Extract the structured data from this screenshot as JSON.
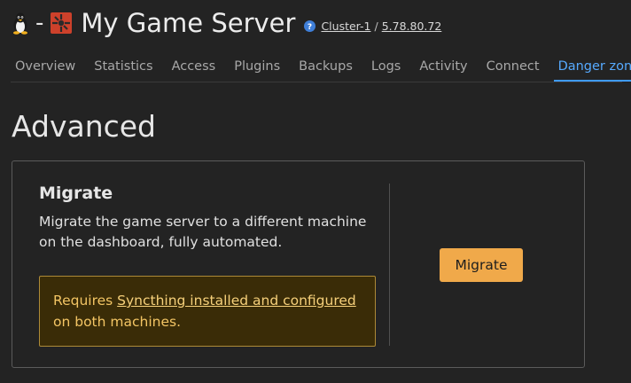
{
  "header": {
    "separator": "-",
    "server_name": "My Game Server",
    "cluster_link": "Cluster-1",
    "breadcrumb_separator": "/",
    "ip_link": "5.78.80.72",
    "help_icon": "question-circle-icon",
    "os_icon": "linux-tux-icon",
    "game_icon": "rust-game-icon"
  },
  "tabs": [
    {
      "label": "Overview",
      "active": false
    },
    {
      "label": "Statistics",
      "active": false
    },
    {
      "label": "Access",
      "active": false
    },
    {
      "label": "Plugins",
      "active": false
    },
    {
      "label": "Backups",
      "active": false
    },
    {
      "label": "Logs",
      "active": false
    },
    {
      "label": "Activity",
      "active": false
    },
    {
      "label": "Connect",
      "active": false
    },
    {
      "label": "Danger zone",
      "active": true
    }
  ],
  "section": {
    "title": "Advanced"
  },
  "migrate_card": {
    "title": "Migrate",
    "description": "Migrate the game server to a different machine on the dashboard, fully automated.",
    "warning_prefix": "Requires ",
    "warning_link": "Syncthing installed and configured",
    "warning_suffix": " on both machines.",
    "button_label": "Migrate"
  },
  "colors": {
    "background": "#232323",
    "accent": "#3f9bff",
    "warning_bg": "#3a2c07",
    "warning_border": "#ad8a37",
    "button_bg": "#f0a94a"
  }
}
